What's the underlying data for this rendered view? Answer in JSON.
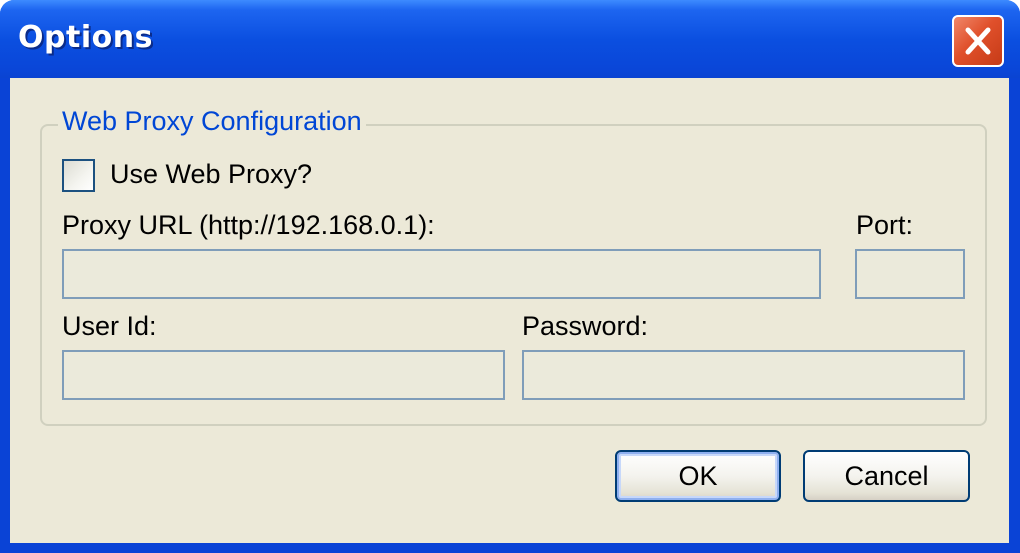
{
  "window": {
    "title": "Options",
    "close_icon": "close-icon"
  },
  "proxy_group": {
    "legend": "Web Proxy Configuration",
    "use_proxy": {
      "label": "Use Web Proxy?",
      "checked": false
    },
    "proxy_url": {
      "label": "Proxy URL (http://192.168.0.1):",
      "value": ""
    },
    "port": {
      "label": "Port:",
      "value": ""
    },
    "user_id": {
      "label": "User Id:",
      "value": ""
    },
    "password": {
      "label": "Password:",
      "value": ""
    }
  },
  "buttons": {
    "ok_label": "OK",
    "cancel_label": "Cancel"
  },
  "colors": {
    "titlebar": "#0a46d8",
    "dialog_bg": "#ece9d8",
    "legend_text": "#0046d5",
    "close_button": "#e0502b",
    "field_border": "#7f9db9"
  }
}
